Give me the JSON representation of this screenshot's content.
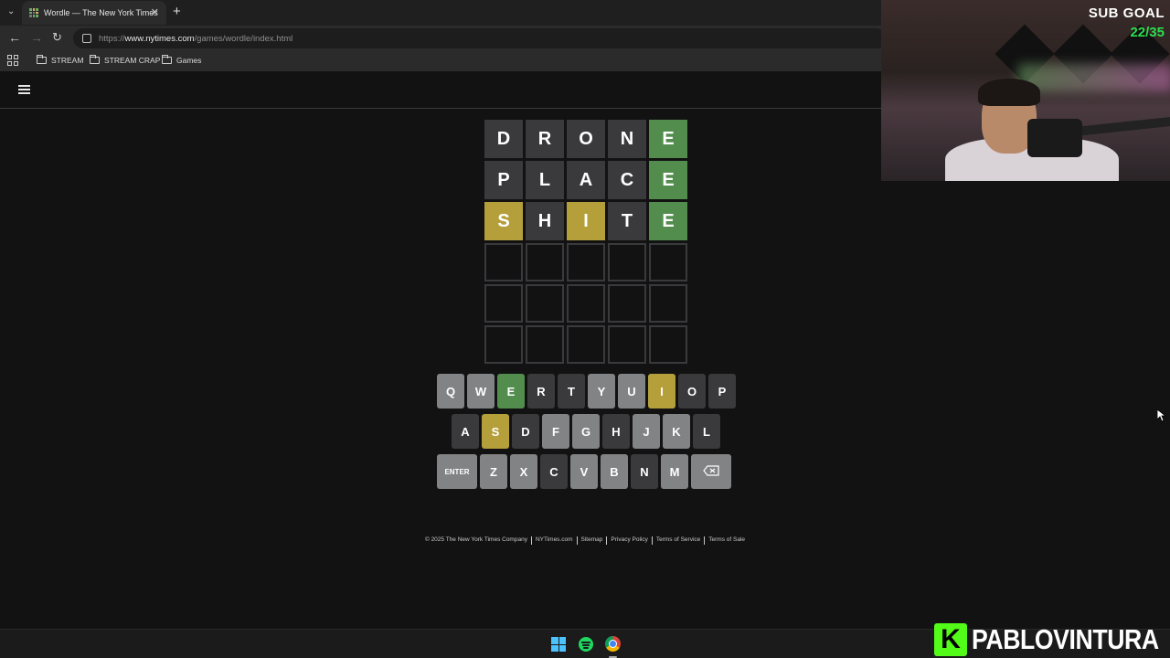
{
  "browser": {
    "tab_title": "Wordle — The New York Times",
    "url_proto": "https://",
    "url_host": "www.nytimes.com",
    "url_path": "/games/wordle/index.html",
    "bookmarks": [
      "STREAM",
      "STREAM CRAP",
      "Games"
    ]
  },
  "board": {
    "rows": [
      [
        {
          "l": "D",
          "s": "absent"
        },
        {
          "l": "R",
          "s": "absent"
        },
        {
          "l": "O",
          "s": "absent"
        },
        {
          "l": "N",
          "s": "absent"
        },
        {
          "l": "E",
          "s": "correct"
        }
      ],
      [
        {
          "l": "P",
          "s": "absent"
        },
        {
          "l": "L",
          "s": "absent"
        },
        {
          "l": "A",
          "s": "absent"
        },
        {
          "l": "C",
          "s": "absent"
        },
        {
          "l": "E",
          "s": "correct"
        }
      ],
      [
        {
          "l": "S",
          "s": "present"
        },
        {
          "l": "H",
          "s": "absent"
        },
        {
          "l": "I",
          "s": "present"
        },
        {
          "l": "T",
          "s": "absent"
        },
        {
          "l": "E",
          "s": "correct"
        }
      ],
      [
        {
          "l": "",
          "s": "empty"
        },
        {
          "l": "",
          "s": "empty"
        },
        {
          "l": "",
          "s": "empty"
        },
        {
          "l": "",
          "s": "empty"
        },
        {
          "l": "",
          "s": "empty"
        }
      ],
      [
        {
          "l": "",
          "s": "empty"
        },
        {
          "l": "",
          "s": "empty"
        },
        {
          "l": "",
          "s": "empty"
        },
        {
          "l": "",
          "s": "empty"
        },
        {
          "l": "",
          "s": "empty"
        }
      ],
      [
        {
          "l": "",
          "s": "empty"
        },
        {
          "l": "",
          "s": "empty"
        },
        {
          "l": "",
          "s": "empty"
        },
        {
          "l": "",
          "s": "empty"
        },
        {
          "l": "",
          "s": "empty"
        }
      ]
    ]
  },
  "keyboard": {
    "rows": [
      [
        {
          "k": "Q",
          "s": ""
        },
        {
          "k": "W",
          "s": ""
        },
        {
          "k": "E",
          "s": "correct"
        },
        {
          "k": "R",
          "s": "absent"
        },
        {
          "k": "T",
          "s": "absent"
        },
        {
          "k": "Y",
          "s": ""
        },
        {
          "k": "U",
          "s": ""
        },
        {
          "k": "I",
          "s": "present"
        },
        {
          "k": "O",
          "s": "absent"
        },
        {
          "k": "P",
          "s": "absent"
        }
      ],
      [
        {
          "k": "A",
          "s": "absent"
        },
        {
          "k": "S",
          "s": "present"
        },
        {
          "k": "D",
          "s": "absent"
        },
        {
          "k": "F",
          "s": ""
        },
        {
          "k": "G",
          "s": ""
        },
        {
          "k": "H",
          "s": "absent"
        },
        {
          "k": "J",
          "s": ""
        },
        {
          "k": "K",
          "s": ""
        },
        {
          "k": "L",
          "s": "absent"
        }
      ],
      [
        {
          "k": "ENTER",
          "s": ""
        },
        {
          "k": "Z",
          "s": ""
        },
        {
          "k": "X",
          "s": ""
        },
        {
          "k": "C",
          "s": "absent"
        },
        {
          "k": "V",
          "s": ""
        },
        {
          "k": "B",
          "s": ""
        },
        {
          "k": "N",
          "s": "absent"
        },
        {
          "k": "M",
          "s": ""
        },
        {
          "k": "backspace",
          "s": ""
        }
      ]
    ]
  },
  "footer": [
    "© 2025 The New York Times Company",
    "NYTimes.com",
    "Sitemap",
    "Privacy Policy",
    "Terms of Service",
    "Terms of Sale"
  ],
  "overlay": {
    "sub_goal_label": "SUB GOAL",
    "sub_goal_count": "22/35",
    "brand_letter": "K",
    "brand_name": "PABLOVINTURA"
  },
  "colors": {
    "correct": "#538d4e",
    "present": "#b59f3b",
    "absent": "#3a3a3c",
    "key_default": "#818384",
    "kick_green": "#53fc18"
  }
}
